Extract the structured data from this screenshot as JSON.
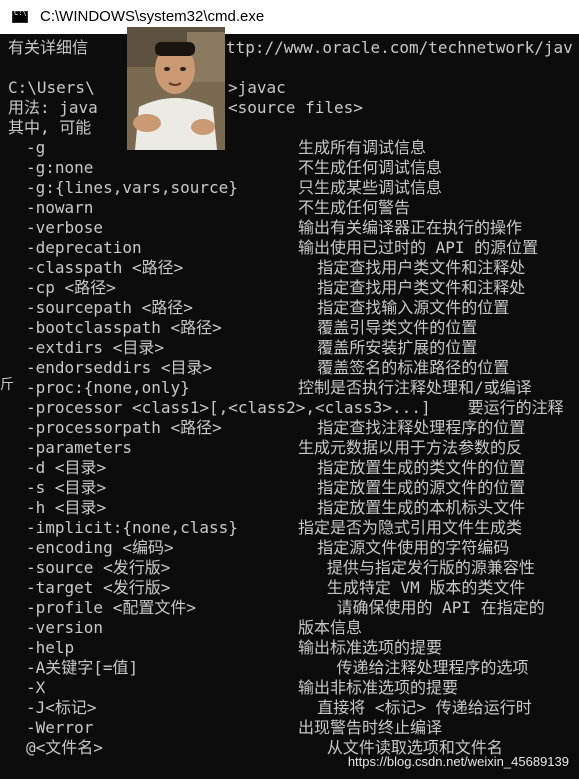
{
  "window": {
    "title": "C:\\WINDOWS\\system32\\cmd.exe",
    "icon": "cmd-icon"
  },
  "console": {
    "header_lines": [
      "有关详细信",
      "ttp://www.oracle.com/technetwork/jav",
      "C:\\Users\\",
      ">javac",
      "用法: java",
      "<source files>",
      "其中, 可能"
    ],
    "options": [
      {
        "opt": "-g",
        "desc": "生成所有调试信息"
      },
      {
        "opt": "-g:none",
        "desc": "不生成任何调试信息"
      },
      {
        "opt": "-g:{lines,vars,source}",
        "desc": "只生成某些调试信息"
      },
      {
        "opt": "-nowarn",
        "desc": "不生成任何警告"
      },
      {
        "opt": "-verbose",
        "desc": "输出有关编译器正在执行的操作"
      },
      {
        "opt": "-deprecation",
        "desc": "输出使用已过时的 API 的源位置"
      },
      {
        "opt": "-classpath <路径>",
        "desc": "  指定查找用户类文件和注释处"
      },
      {
        "opt": "-cp <路径>",
        "desc": "  指定查找用户类文件和注释处"
      },
      {
        "opt": "-sourcepath <路径>",
        "desc": "  指定查找输入源文件的位置"
      },
      {
        "opt": "-bootclasspath <路径>",
        "desc": "  覆盖引导类文件的位置"
      },
      {
        "opt": "-extdirs <目录>",
        "desc": "  覆盖所安装扩展的位置"
      },
      {
        "opt": "-endorseddirs <目录>",
        "desc": "  覆盖签名的标准路径的位置"
      },
      {
        "opt": "-proc:{none,only}",
        "desc": "控制是否执行注释处理和/或编译"
      },
      {
        "opt": "-processor <class1>[,<class2>,<class3>...]",
        "desc": " 要运行的注释"
      },
      {
        "opt": "-processorpath <路径>",
        "desc": "  指定查找注释处理程序的位置"
      },
      {
        "opt": "-parameters",
        "desc": "生成元数据以用于方法参数的反"
      },
      {
        "opt": "-d <目录>",
        "desc": "  指定放置生成的类文件的位置"
      },
      {
        "opt": "-s <目录>",
        "desc": "  指定放置生成的源文件的位置"
      },
      {
        "opt": "-h <目录>",
        "desc": "  指定放置生成的本机标头文件"
      },
      {
        "opt": "-implicit:{none,class}",
        "desc": "指定是否为隐式引用文件生成类"
      },
      {
        "opt": "-encoding <编码>",
        "desc": "  指定源文件使用的字符编码"
      },
      {
        "opt": "-source <发行版>",
        "desc": "   提供与指定发行版的源兼容性"
      },
      {
        "opt": "-target <发行版>",
        "desc": "   生成特定 VM 版本的类文件"
      },
      {
        "opt": "-profile <配置文件>",
        "desc": "    请确保使用的 API 在指定的"
      },
      {
        "opt": "-version",
        "desc": "版本信息"
      },
      {
        "opt": "-help",
        "desc": "输出标准选项的提要"
      },
      {
        "opt": "-A关键字[=值]",
        "desc": "    传递给注释处理程序的选项"
      },
      {
        "opt": "-X",
        "desc": "输出非标准选项的提要"
      },
      {
        "opt": "-J<标记>",
        "desc": "  直接将 <标记> 传递给运行时"
      },
      {
        "opt": "-Werror",
        "desc": "出现警告时终止编译"
      },
      {
        "opt": "@<文件名>",
        "desc": "   从文件读取选项和文件名"
      }
    ],
    "left_glyph": "斤"
  },
  "watermark": "https://blog.csdn.net/weixin_45689139"
}
